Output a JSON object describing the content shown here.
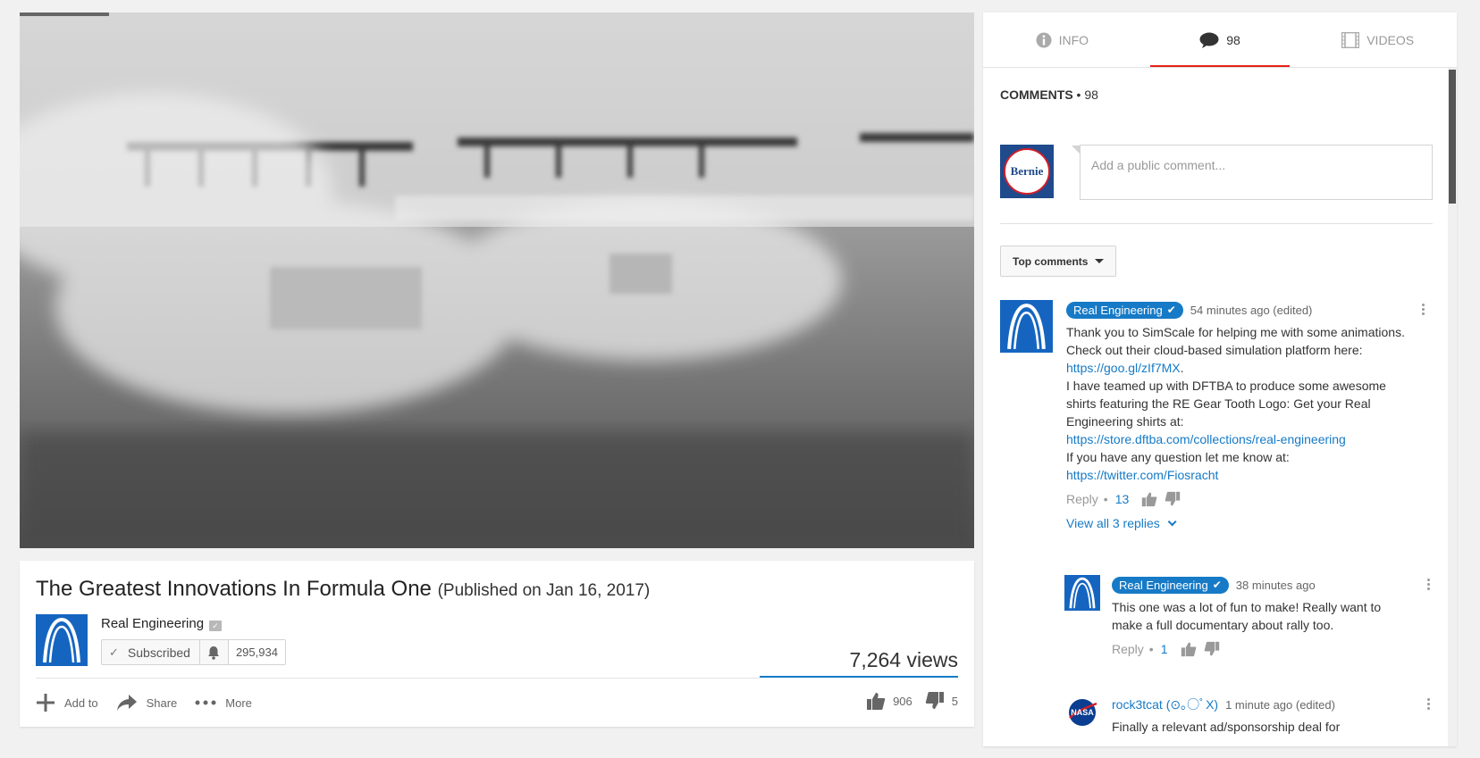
{
  "video": {
    "title": "The Greatest Innovations In Formula One",
    "published": "(Published on Jan 16, 2017)",
    "channel": "Real Engineering",
    "subscribe_label": "Subscribed",
    "subscriber_count": "295,934",
    "views": "7,264 views",
    "add_to_label": "Add to",
    "share_label": "Share",
    "more_label": "More",
    "likes": "906",
    "dislikes": "5"
  },
  "tabs": [
    {
      "label": "INFO",
      "icon": "info-icon"
    },
    {
      "label": "98",
      "icon": "comment-icon"
    },
    {
      "label": "VIDEOS",
      "icon": "film-icon"
    }
  ],
  "comments_section": {
    "header_label": "COMMENTS",
    "header_count": "98",
    "input_placeholder": "Add a public comment...",
    "avatar_text": "Bernie",
    "sort_label": "Top comments"
  },
  "comments": [
    {
      "author": "Real Engineering",
      "time": "54 minutes ago (edited)",
      "text1": "Thank you to SimScale for helping me with some animations. Check out their cloud-based simulation platform here: ",
      "link1": "https://goo.gl/zIf7MX",
      "text1_end": ".",
      "text2": "I have teamed up with DFTBA to produce some awesome shirts featuring the RE Gear Tooth Logo: Get your Real Engineering shirts at:",
      "link2": "https://store.dftba.com/collections/real-engineering",
      "text3": "If you have any question let me know at:",
      "link3": "https://twitter.com/Fiosracht",
      "reply_label": "Reply",
      "likes": "13",
      "view_replies": "View all 3 replies"
    },
    {
      "author": "Real Engineering",
      "time": "38 minutes ago",
      "text": "This one was a lot of fun to make! Really want to make a full documentary about rally too.",
      "reply_label": "Reply",
      "likes": "1"
    },
    {
      "author": "rock3tcat (⊙｡○ﾟX)",
      "time": "1 minute ago (edited)",
      "text": "Finally a relevant ad/sponsorship deal for",
      "avatar_text": "NASA"
    }
  ],
  "colors": {
    "accent": "#167ac6",
    "tab_underline": "#e62117",
    "avatar_blue": "#1565c0"
  }
}
